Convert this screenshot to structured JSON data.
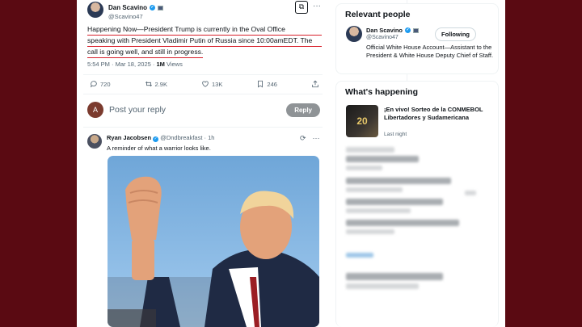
{
  "main_tweet": {
    "author_name": "Dan Scavino",
    "author_handle": "@Scavino47",
    "text_lines": [
      "Happening Now—President Trump is currently in the Oval Office",
      "speaking with President Vladimir Putin of Russia since 10:00amEDT. The",
      "call is going well, and still in progress."
    ],
    "time": "5:54 PM · Mar 18, 2025 · ",
    "views_count": "1M",
    "views_label": " Views",
    "replies": "720",
    "reposts": "2.9K",
    "likes": "13K",
    "bookmarks": "246"
  },
  "reply_box": {
    "avatar_letter": "A",
    "placeholder": "Post your reply",
    "button": "Reply"
  },
  "reply_tweet": {
    "author_name": "Ryan Jacobsen",
    "author_handle": "@Dndbreakfast",
    "time": "· 1h",
    "text": "A reminder of what a warrior looks like."
  },
  "relevant_people": {
    "title": "Relevant people",
    "name": "Dan Scavino",
    "handle": "@Scavino47",
    "follow_label": "Following",
    "bio": "Official White House Account—Assistant to the President & White House Deputy Chief of Staff."
  },
  "whats_happening": {
    "title": "What's happening",
    "trend_image_text": "20",
    "trend_title": "¡En vivo! Sorteo de la CONMEBOL Libertadores y Sudamericana",
    "trend_sub": "Last night"
  },
  "colors": {
    "underline": "#d8202a",
    "verified": "#1d9bf0",
    "background": "#5a0a12"
  },
  "icons": [
    "verified-icon",
    "flag-icon",
    "grok-icon",
    "more-icon",
    "reply-icon",
    "repost-icon",
    "like-icon",
    "bookmark-icon",
    "share-icon"
  ]
}
